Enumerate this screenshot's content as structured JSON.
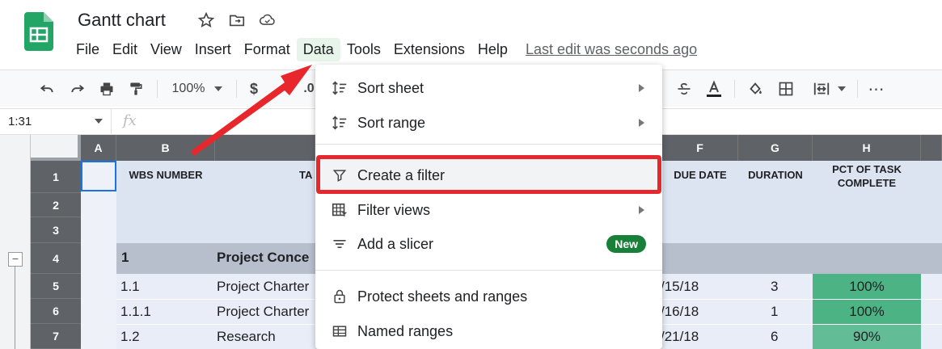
{
  "app": {
    "doc_title": "Gantt chart",
    "last_edit": "Last edit was seconds ago"
  },
  "menu": [
    {
      "label": "File"
    },
    {
      "label": "Edit"
    },
    {
      "label": "View"
    },
    {
      "label": "Insert"
    },
    {
      "label": "Format"
    },
    {
      "label": "Data"
    },
    {
      "label": "Tools"
    },
    {
      "label": "Extensions"
    },
    {
      "label": "Help"
    }
  ],
  "toolbar": {
    "zoom": "100%",
    "currency": "$",
    "partial_decimal": ".0"
  },
  "formula_bar": {
    "name_box": "1:31",
    "fx": "fx"
  },
  "columns": [
    "A",
    "B",
    "F",
    "G",
    "H"
  ],
  "rows": [
    "1",
    "2",
    "3",
    "4",
    "5",
    "6",
    "7"
  ],
  "headers": {
    "wbs": "WBS NUMBER",
    "task_partial": "TA",
    "due_date": "DUE DATE",
    "duration": "DURATION",
    "pct_complete_1": "PCT OF TASK",
    "pct_complete_2": "COMPLETE"
  },
  "data_rows": [
    {
      "wbs": "1",
      "task": "Project Conce",
      "due": "",
      "duration": "",
      "pct": ""
    },
    {
      "wbs": "1.1",
      "task": "Project Charter",
      "due": "/15/18",
      "duration": "3",
      "pct": "100%"
    },
    {
      "wbs": "1.1.1",
      "task": "Project Charter",
      "due": "/16/18",
      "duration": "1",
      "pct": "100%"
    },
    {
      "wbs": "1.2",
      "task": "Research",
      "due": "/21/18",
      "duration": "6",
      "pct": "90%"
    }
  ],
  "dropdown": {
    "sort_sheet": "Sort sheet",
    "sort_range": "Sort range",
    "create_filter": "Create a filter",
    "filter_views": "Filter views",
    "add_slicer": "Add a slicer",
    "new_badge": "New",
    "protect": "Protect sheets and ranges",
    "named_ranges": "Named ranges"
  },
  "colors": {
    "accent_red": "#e8272c",
    "sheets_green": "#23a566",
    "header_gray": "#5f6368",
    "pct_green": "#57bb8a"
  },
  "icons": [
    "sheets-logo-icon",
    "star-icon",
    "move-folder-icon",
    "cloud-status-icon",
    "undo-icon",
    "redo-icon",
    "print-icon",
    "paint-format-icon",
    "strikethrough-icon",
    "text-color-icon",
    "fill-color-icon",
    "borders-icon",
    "merge-cells-icon",
    "more-icon",
    "sort-icon",
    "filter-icon",
    "filter-views-icon",
    "slicer-icon",
    "lock-icon",
    "named-ranges-icon"
  ]
}
